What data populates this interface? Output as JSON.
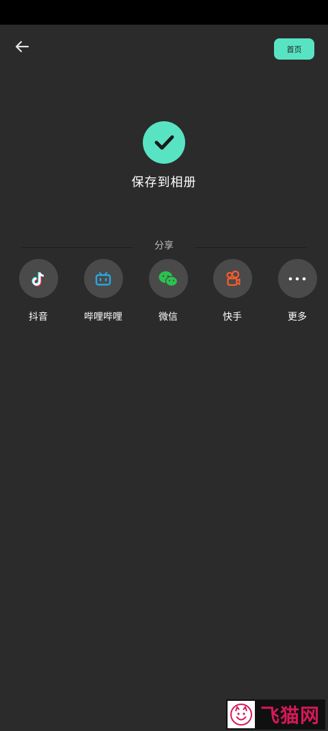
{
  "header": {
    "back_icon": "arrow-left-icon",
    "home_label": "首页"
  },
  "result": {
    "icon": "check-icon",
    "title": "保存到相册"
  },
  "share": {
    "label": "分享",
    "items": [
      {
        "label": "抖音",
        "icon": "douyin-icon",
        "color": "#ffffff"
      },
      {
        "label": "哔哩哔哩",
        "icon": "bilibili-icon",
        "color": "#29a8e0"
      },
      {
        "label": "微信",
        "icon": "wechat-icon",
        "color": "#2ac24f"
      },
      {
        "label": "快手",
        "icon": "kuaishou-icon",
        "color": "#ff5b29"
      },
      {
        "label": "更多",
        "icon": "more-icon",
        "color": "#ffffff"
      }
    ]
  },
  "watermark": {
    "text": "飞猫网"
  },
  "colors": {
    "accent": "#58e4c3",
    "background": "#2b2b2b",
    "circle": "#4a4a4a"
  }
}
